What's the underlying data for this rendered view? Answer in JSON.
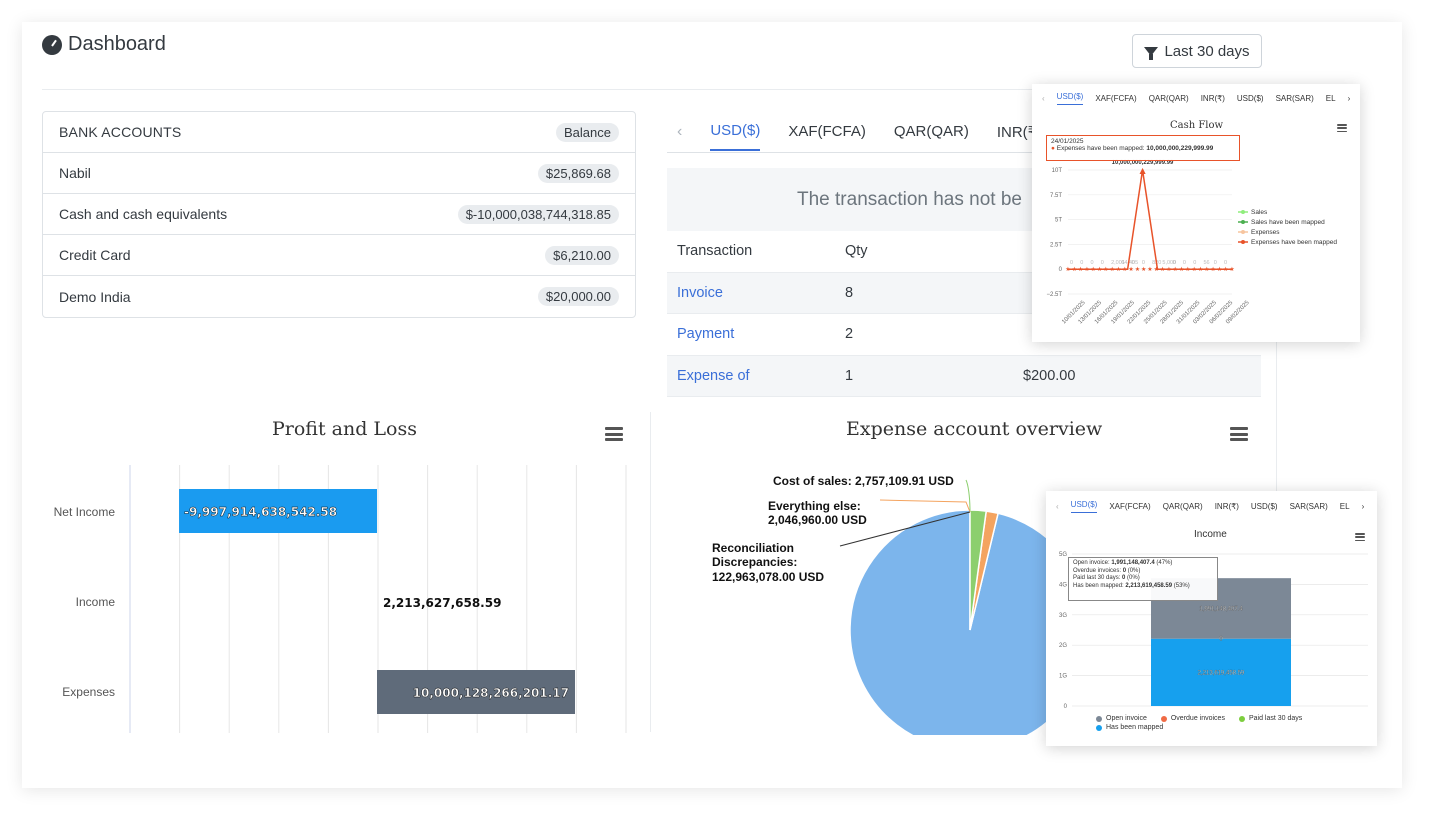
{
  "header": {
    "title": "Dashboard",
    "filter_label": "Last 30 days"
  },
  "bank_accounts": {
    "heading": "BANK ACCOUNTS",
    "balance_label": "Balance",
    "rows": [
      {
        "name": "Nabil",
        "amount": "$25,869.68"
      },
      {
        "name": "Cash and cash equivalents",
        "amount": "$-10,000,038,744,318.85"
      },
      {
        "name": "Credit Card",
        "amount": "$6,210.00"
      },
      {
        "name": "Demo India",
        "amount": "$20,000.00"
      }
    ]
  },
  "currency_tabs": [
    "USD($)",
    "XAF(FCFA)",
    "QAR(QAR)",
    "INR(₹)"
  ],
  "transactions": {
    "banner": "The transaction has not be",
    "columns": [
      "Transaction",
      "Qty"
    ],
    "rows": [
      {
        "name": "Invoice",
        "qty": "8",
        "amount": ""
      },
      {
        "name": "Payment",
        "qty": "2",
        "amount": ""
      },
      {
        "name": "Expense of",
        "qty": "1",
        "amount": "$200.00"
      }
    ]
  },
  "profit_loss": {
    "title": "Profit and Loss",
    "chart_data": {
      "type": "bar",
      "categories": [
        "Net Income",
        "Income",
        "Expenses"
      ],
      "values": [
        -9997914638542.58,
        2213627658.59,
        10000128266201.17
      ],
      "labels": [
        "-9,997,914,638,542.58",
        "2,213,627,658.59",
        "10,000,128,266,201.17"
      ],
      "colors": [
        "#1a9bf0",
        "#ffffff",
        "#5f6b7a"
      ]
    }
  },
  "expense_overview": {
    "title": "Expense account overview",
    "chart_data": {
      "type": "pie",
      "labels": [
        [
          "Cost of sales: 2,757,109.91 USD"
        ],
        [
          "Everything else:",
          "2,046,960.00 USD"
        ],
        [
          "Reconciliation",
          "Discrepancies:",
          "122,963,078.00 USD"
        ]
      ],
      "categories": [
        "Cost of sales",
        "Everything else",
        "Reconciliation Discrepancies"
      ],
      "values": [
        2757109.91,
        2046960.0,
        122963078.0
      ],
      "colors": [
        "#8ccf6e",
        "#f4a460",
        "#7cb5ec"
      ]
    }
  },
  "cashflow_popup": {
    "tabs": [
      "USD($)",
      "XAF(FCFA)",
      "QAR(QAR)",
      "INR(₹)",
      "USD($)",
      "SAR(SAR)",
      "EL",
      "›"
    ],
    "title": "Cash Flow",
    "tooltip_date": "24/01/2025",
    "tooltip_text": "Expenses have been mapped:",
    "tooltip_value": "10,000,000,229,999.99",
    "peak_label": "10,000,000,229,999.99",
    "y_ticks": [
      "10T",
      "7.5T",
      "5T",
      "2.5T",
      "0",
      "−2.5T"
    ],
    "x_ticks": [
      "10/01/2025",
      "13/01/2025",
      "16/01/2025",
      "19/01/2025",
      "22/01/2025",
      "25/01/2025",
      "28/01/2025",
      "31/01/2025",
      "03/02/2025",
      "06/02/2025",
      "09/02/2025"
    ],
    "small_labels": [
      "0",
      "0",
      "0",
      "0",
      "2,001",
      "64,405",
      "0",
      "0",
      "820",
      "5,000",
      "0",
      "0",
      "0",
      "56",
      "0",
      "0"
    ],
    "legend": [
      "Sales",
      "Sales have been mapped",
      "Expenses",
      "Expenses have been mapped"
    ],
    "colors": {
      "sales": "#90ed7d",
      "sales_mapped": "#4caf50",
      "expenses": "#f7c59f",
      "expenses_mapped": "#e8532a"
    },
    "chart_data": {
      "type": "line",
      "x": [
        "10/01/2025",
        "13/01/2025",
        "16/01/2025",
        "19/01/2025",
        "22/01/2025",
        "24/01/2025",
        "25/01/2025",
        "28/01/2025",
        "31/01/2025",
        "03/02/2025",
        "06/02/2025",
        "09/02/2025"
      ],
      "series": [
        {
          "name": "Expenses have been mapped",
          "values": [
            0,
            0,
            0,
            0,
            0,
            10000000229999.99,
            0,
            0,
            0,
            0,
            0,
            0
          ]
        }
      ],
      "ylim": [
        -2500000000000.0,
        10000000000000.0
      ]
    }
  },
  "income_popup": {
    "tabs": [
      "USD($)",
      "XAF(FCFA)",
      "QAR(QAR)",
      "INR(₹)",
      "USD($)",
      "SAR(SAR)",
      "EL",
      "›"
    ],
    "title": "Income",
    "tooltip_lines": [
      {
        "label": "Open invoice: ",
        "value": "1,991,148,407.4",
        "pct": " (47%)"
      },
      {
        "label": "Overdue invoices: ",
        "value": "0",
        "pct": " (0%)"
      },
      {
        "label": "Paid last 30 days: ",
        "value": "0",
        "pct": " (0%)"
      },
      {
        "label": "Has been mapped: ",
        "value": "2,213,619,458.59",
        "pct": " (53%)"
      }
    ],
    "y_ticks": [
      "5G",
      "4G",
      "3G",
      "2G",
      "1G",
      "0"
    ],
    "bar_labels": [
      "1,991,148,407.4",
      "0",
      "2,213,619,458.59"
    ],
    "legend": [
      "Open invoice",
      "Overdue invoices",
      "Paid last 30 days",
      "Has been mapped"
    ],
    "colors": [
      "#7c8896",
      "#f06a45",
      "#7dce3e",
      "#16a0ee"
    ],
    "chart_data": {
      "type": "bar",
      "stacked": true,
      "series": [
        {
          "name": "Open invoice",
          "values": [
            1991148407.4
          ]
        },
        {
          "name": "Overdue invoices",
          "values": [
            0
          ]
        },
        {
          "name": "Paid last 30 days",
          "values": [
            0
          ]
        },
        {
          "name": "Has been mapped",
          "values": [
            2213619458.59
          ]
        }
      ],
      "ylim": [
        0,
        5000000000
      ]
    }
  }
}
